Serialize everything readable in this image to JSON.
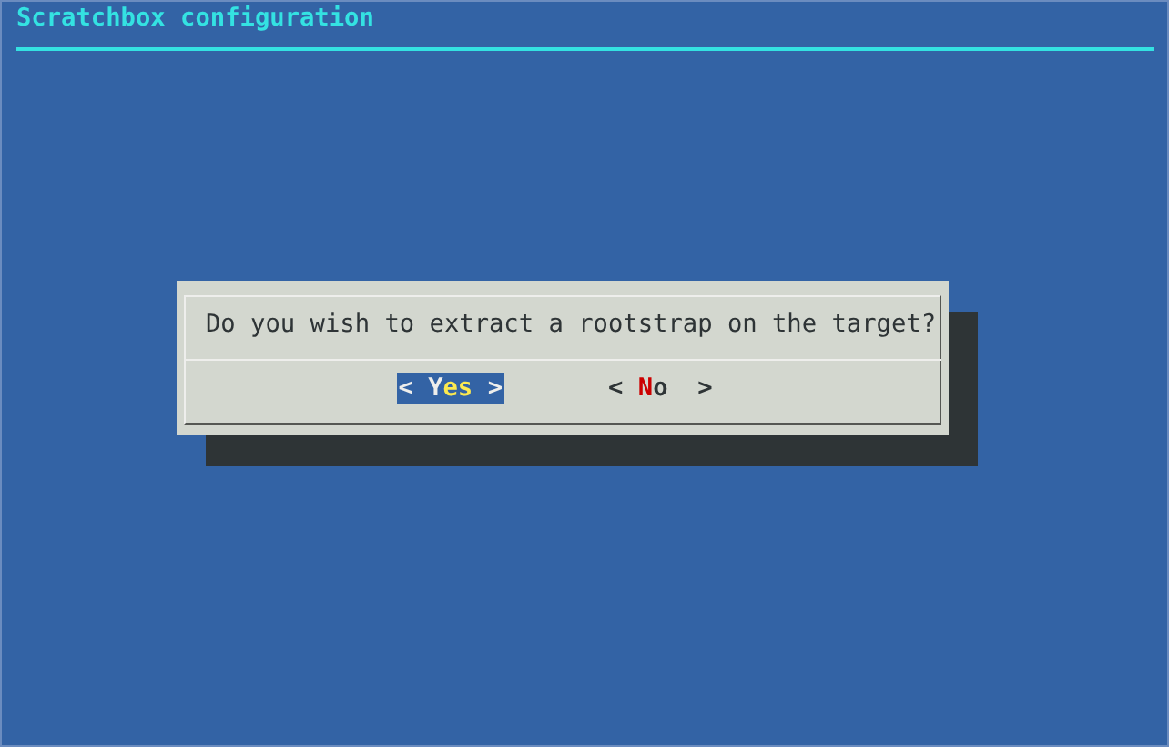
{
  "backtitle": "Scratchbox configuration",
  "dialog": {
    "message": "Do you wish to extract a rootstrap on the target?",
    "buttons": [
      {
        "open": "<",
        "hotkey": "Y",
        "rest": "es",
        "close": ">",
        "selected": true
      },
      {
        "open": "<",
        "hotkey": "N",
        "rest": "o ",
        "close": ">",
        "selected": false
      }
    ]
  }
}
